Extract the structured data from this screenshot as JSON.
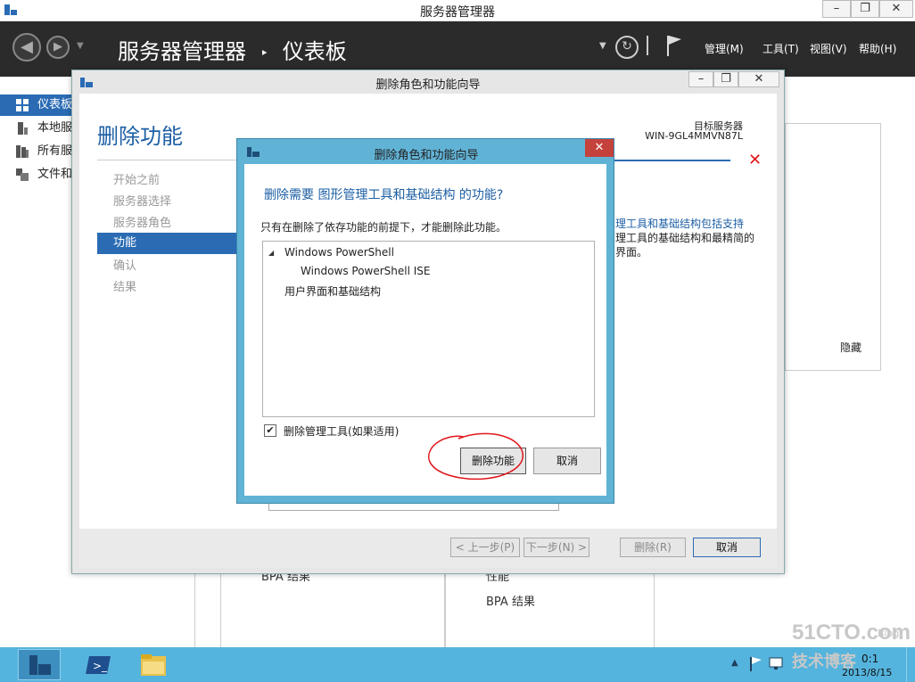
{
  "window": {
    "title": "服务器管理器"
  },
  "header": {
    "breadcrumb_root": "服务器管理器",
    "separator": "‣",
    "breadcrumb_current": "仪表板",
    "menus": [
      "管理(M)",
      "工具(T)",
      "视图(V)",
      "帮助(H)"
    ]
  },
  "sidebar": {
    "items": [
      {
        "label": "仪表板",
        "icon": "dashboard-icon"
      },
      {
        "label": "本地服",
        "icon": "local-server-icon"
      },
      {
        "label": "所有服",
        "icon": "all-servers-icon"
      },
      {
        "label": "文件和",
        "icon": "file-services-icon"
      }
    ]
  },
  "background": {
    "hide_label": "隐藏",
    "bpa_left": "BPA 结果",
    "perf_label": "性能",
    "bpa_right": "BPA 结果",
    "desc_line1": "理工具和基础结构包括支持",
    "desc_line2": "理工具的基础结构和最精简的",
    "desc_line3": "界面。"
  },
  "wizard": {
    "title": "删除角色和功能向导",
    "heading": "删除功能",
    "target_label": "目标服务器",
    "target_server": "WIN-9GL4MMVN87L",
    "steps": [
      "开始之前",
      "服务器选择",
      "服务器角色",
      "功能",
      "确认",
      "结果"
    ],
    "active_step_index": 3,
    "buttons": {
      "prev": "< 上一步(P)",
      "next": "下一步(N) >",
      "remove": "删除(R)",
      "cancel": "取消"
    }
  },
  "dialog": {
    "title": "删除角色和功能向导",
    "question": "删除需要 图形管理工具和基础结构 的功能?",
    "description": "只有在删除了依存功能的前提下，才能删除此功能。",
    "tree": [
      {
        "label": "Windows PowerShell",
        "level": 0,
        "expanded": true
      },
      {
        "label": "Windows PowerShell ISE",
        "level": 1
      },
      {
        "label": "用户界面和基础结构",
        "level": 0
      }
    ],
    "checkbox_label": "删除管理工具(如果适用)",
    "checkbox_checked": true,
    "remove_button": "删除功能",
    "cancel_button": "取消"
  },
  "taskbar": {
    "time": "0:1",
    "date": "2013/8/15"
  },
  "watermark": {
    "line1": "51CTO.com",
    "line2": "技术博客",
    "line3": "Blog"
  },
  "colors": {
    "accent": "#2a6bb4",
    "heading": "#1d5fa5",
    "dialog_frame": "#61b3d6",
    "taskbar": "#55b4dd",
    "close": "#c4413c",
    "annotation": "#e0161b"
  }
}
